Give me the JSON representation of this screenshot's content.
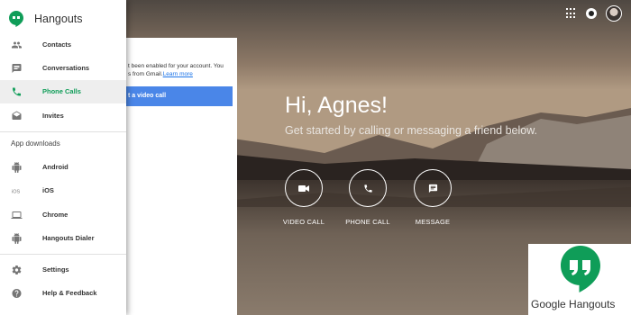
{
  "app": {
    "title": "Hangouts"
  },
  "colors": {
    "accent": "#0f9d58",
    "link": "#1a73e8",
    "cta": "#4a86e8"
  },
  "topbar": {
    "icons": [
      "apps-grid-icon",
      "status-icon",
      "avatar"
    ]
  },
  "sidebar": {
    "items": [
      {
        "label": "Contacts",
        "icon": "people-icon"
      },
      {
        "label": "Conversations",
        "icon": "chat-icon"
      },
      {
        "label": "Phone Calls",
        "icon": "phone-icon",
        "active": true
      },
      {
        "label": "Invites",
        "icon": "mail-icon"
      }
    ],
    "downloads_heading": "App downloads",
    "downloads": [
      {
        "label": "Android",
        "icon": "android-icon"
      },
      {
        "label": "iOS",
        "icon": "ios-icon"
      },
      {
        "label": "Chrome",
        "icon": "laptop-icon"
      },
      {
        "label": "Hangouts Dialer",
        "icon": "android-icon"
      }
    ],
    "footer": [
      {
        "label": "Settings",
        "icon": "gear-icon"
      },
      {
        "label": "Help & Feedback",
        "icon": "help-icon"
      }
    ]
  },
  "card": {
    "line1": "t been enabled for your account. You",
    "line2": "s from Gmail.",
    "link": "Learn more",
    "cta": "t a video call"
  },
  "main": {
    "greeting": "Hi, Agnes!",
    "subtitle": "Get started by calling or messaging a friend below.",
    "actions": [
      {
        "label": "VIDEO CALL",
        "icon": "videocam-icon"
      },
      {
        "label": "PHONE CALL",
        "icon": "phone-icon"
      },
      {
        "label": "MESSAGE",
        "icon": "message-icon"
      }
    ]
  },
  "logo_box": {
    "text": "Google Hangouts"
  }
}
